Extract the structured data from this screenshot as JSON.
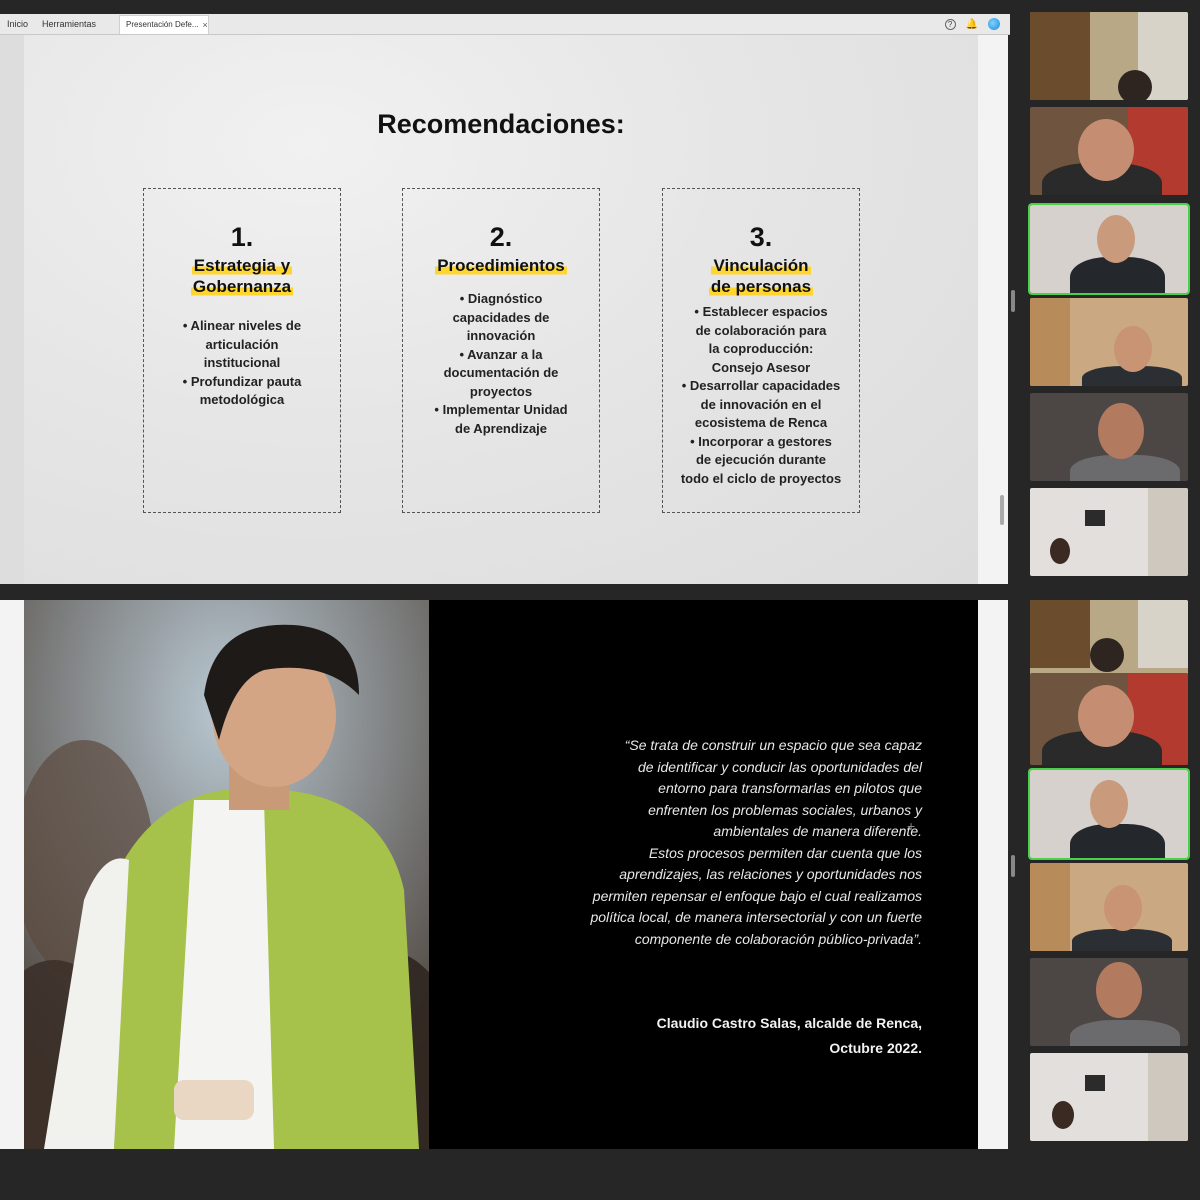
{
  "toolbar": {
    "home": "Inicio",
    "tools": "Herramientas",
    "tab_title": "Presentación Defe...",
    "tab_close": "×",
    "help": "?"
  },
  "slide1": {
    "title": "Recomendaciones:",
    "cards": [
      {
        "number": "1.",
        "heading_lines": [
          "Estrategia y",
          "Gobernanza"
        ],
        "bullets": [
          "• Alinear niveles de",
          "articulación",
          "institucional",
          "• Profundizar pauta",
          "metodológica"
        ]
      },
      {
        "number": "2.",
        "heading_lines": [
          "Procedimientos"
        ],
        "bullets": [
          "• Diagnóstico",
          "capacidades de",
          "innovación",
          "• Avanzar a la",
          "documentación de",
          "proyectos",
          "• Implementar Unidad",
          "de Aprendizaje"
        ]
      },
      {
        "number": "3.",
        "heading_lines": [
          "Vinculación",
          "de personas"
        ],
        "bullets": [
          "• Establecer espacios",
          "de colaboración para",
          "la coproducción:",
          "Consejo Asesor",
          "• Desarrollar capacidades",
          "de innovación en el",
          "ecosistema de Renca",
          "• Incorporar a gestores",
          "de ejecución durante",
          "todo el ciclo de proyectos"
        ]
      }
    ]
  },
  "slide2": {
    "quote_lines": [
      "“Se trata de construir un espacio que sea capaz",
      "de identificar y conducir las oportunidades del",
      "entorno para transformarlas en pilotos que",
      "enfrenten los problemas sociales, urbanos y",
      "ambientales de manera diferente.",
      "Estos procesos permiten dar cuenta que los",
      "aprendizajes, las relaciones y oportunidades nos",
      "permiten repensar el enfoque bajo el cual realizamos",
      "política local, de manera intersectorial y con un fuerte",
      "componente de colaboración público-privada”."
    ],
    "author_lines": [
      "Claudio Castro Salas, alcalde de Renca,",
      "Octubre 2022."
    ]
  },
  "colors": {
    "highlight": "#ffd530",
    "active_speaker": "#4ad14a"
  }
}
